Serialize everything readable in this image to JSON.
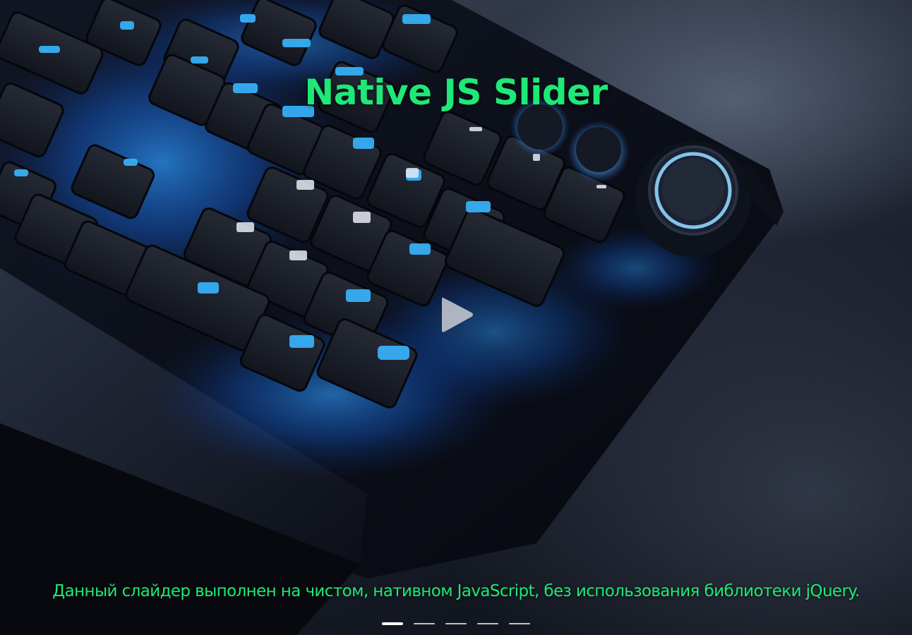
{
  "slider": {
    "title": "Native JS Slider",
    "caption": "Данный слайдер выполнен на чистом, нативном JavaScript, без использования библиотеки jQuery.",
    "play_icon": "play-icon",
    "background_description_colors": {
      "title_color": "#1ee878",
      "caption_color": "#1ee878",
      "key_glow": "#1a8cff"
    },
    "pagination": {
      "total": 5,
      "active_index": 0
    }
  }
}
